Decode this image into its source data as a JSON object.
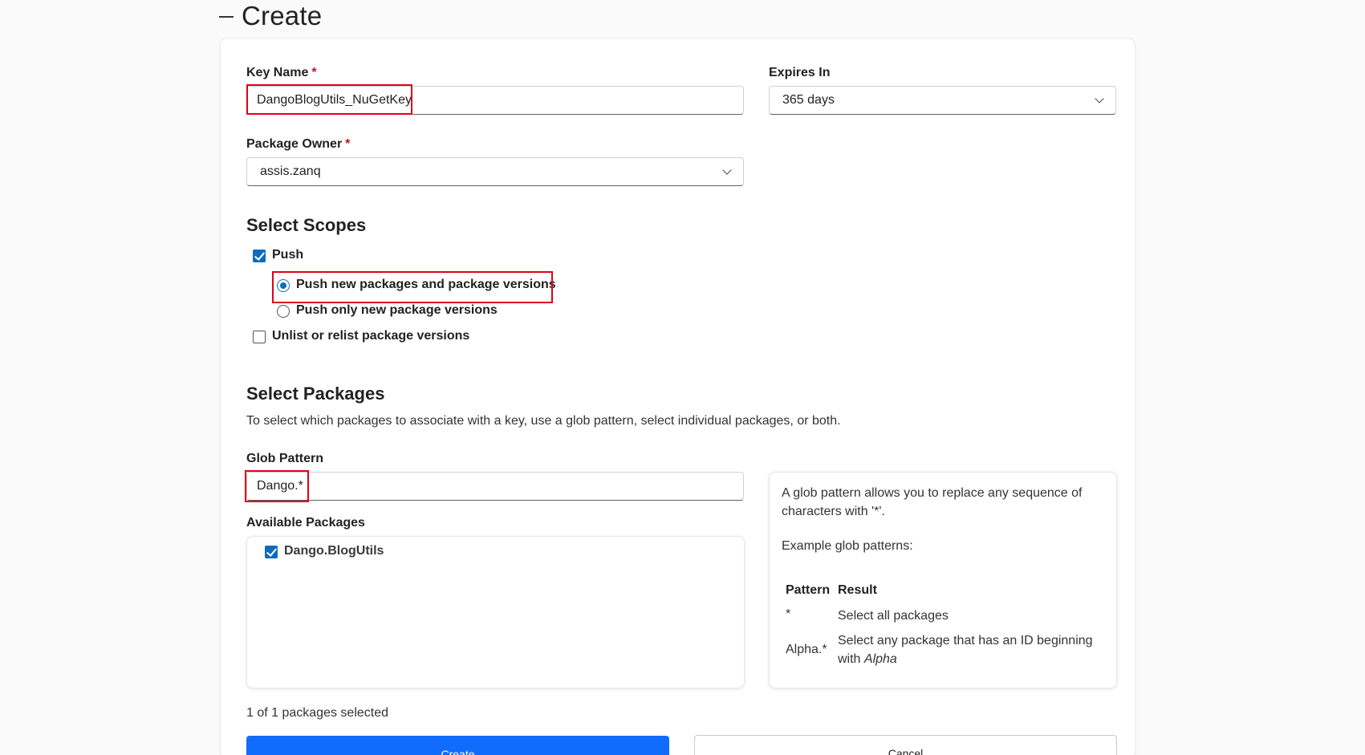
{
  "section": {
    "title": "Create"
  },
  "key_name": {
    "label": "Key Name",
    "required_mark": "*",
    "value": "DangoBlogUtils_NuGetKey"
  },
  "expires_in": {
    "label": "Expires In",
    "value": "365 days"
  },
  "package_owner": {
    "label": "Package Owner",
    "required_mark": "*",
    "value": "assis.zanq"
  },
  "scopes": {
    "heading": "Select Scopes",
    "push_label": "Push",
    "push_checked": true,
    "push_options": [
      {
        "label": "Push new packages and package versions",
        "selected": true
      },
      {
        "label": "Push only new package versions",
        "selected": false
      }
    ],
    "unlist_label": "Unlist or relist package versions",
    "unlist_checked": false
  },
  "packages": {
    "heading": "Select Packages",
    "description": "To select which packages to associate with a key, use a glob pattern, select individual packages, or both.",
    "glob_label": "Glob Pattern",
    "glob_value": "Dango.*",
    "available_label": "Available Packages",
    "items": [
      {
        "label": "Dango.BlogUtils",
        "checked": true
      }
    ],
    "selected_count": "1 of 1 packages selected"
  },
  "glob_help": {
    "intro": "A glob pattern allows you to replace any sequence of characters with '*'.",
    "examples_title": "Example glob patterns:",
    "col_pattern": "Pattern",
    "col_result": "Result",
    "rows": [
      {
        "pattern": "*",
        "result": "Select all packages"
      },
      {
        "pattern": "Alpha.*",
        "result_prefix": "Select any package that has an ID beginning with ",
        "result_em": "Alpha"
      }
    ]
  },
  "actions": {
    "create_label": "Create",
    "cancel_label": "Cancel"
  },
  "colors": {
    "primary": "#0f6cfd",
    "highlight": "#e0001b",
    "check": "#0f6cbd"
  }
}
